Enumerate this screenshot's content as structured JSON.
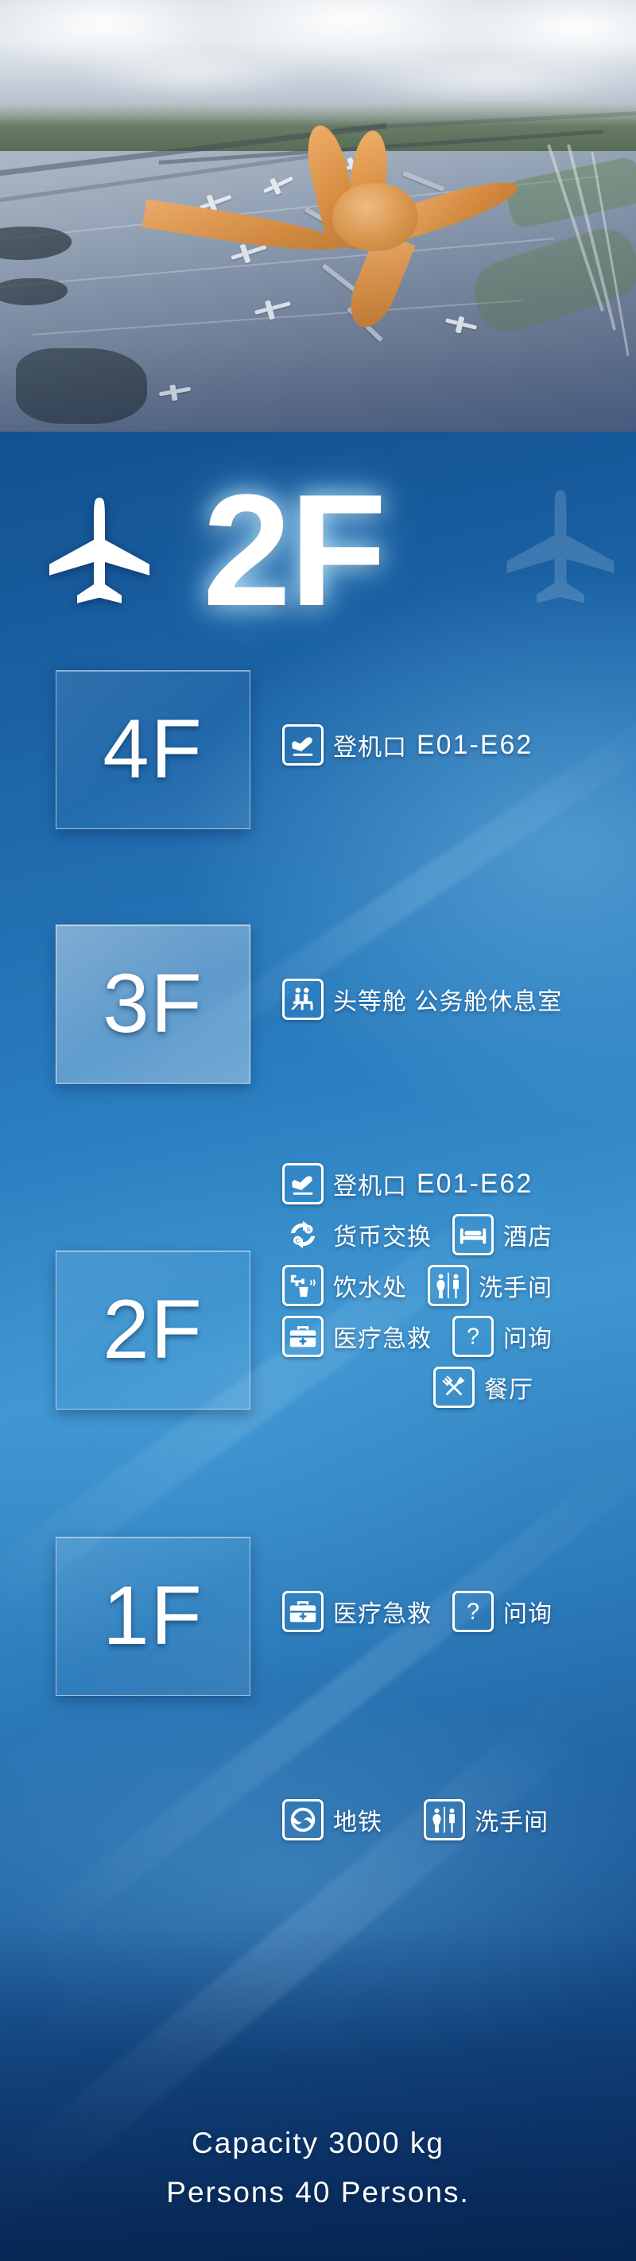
{
  "photo": {
    "alt_description": "Aerial rendering of Beijing Daxing International Airport terminal",
    "name": "airport-aerial-photo"
  },
  "header": {
    "floor_label": "2F",
    "plane_icon": "airplane-icon",
    "ghost_plane_icon": "airplane-watermark-icon"
  },
  "floors": [
    {
      "id": "4f",
      "label": "4F",
      "highlighted": false,
      "services": [
        [
          {
            "icon": "departure-plane-icon",
            "boxed": true,
            "label": "登机口",
            "code": "E01-E62"
          }
        ]
      ]
    },
    {
      "id": "3f",
      "label": "3F",
      "highlighted": true,
      "services": [
        [
          {
            "icon": "lounge-seat-icon",
            "boxed": true,
            "label": "头等舱  公务舱休息室",
            "code": ""
          }
        ]
      ]
    },
    {
      "id": "2f",
      "label": "2F",
      "highlighted": false,
      "services": [
        [
          {
            "icon": "departure-plane-icon",
            "boxed": true,
            "label": "登机口",
            "code": "E01-E62"
          }
        ],
        [
          {
            "icon": "currency-exchange-icon",
            "boxed": false,
            "label": "货币交换",
            "code": ""
          },
          {
            "icon": "hotel-bed-icon",
            "boxed": true,
            "label": "酒店",
            "code": ""
          }
        ],
        [
          {
            "icon": "drinking-water-icon",
            "boxed": true,
            "label": "饮水处",
            "code": ""
          },
          {
            "icon": "restroom-icon",
            "boxed": true,
            "label": "洗手间",
            "code": ""
          }
        ],
        [
          {
            "icon": "first-aid-kit-icon",
            "boxed": true,
            "label": "医疗急救",
            "code": ""
          },
          {
            "icon": "question-mark-icon",
            "boxed": true,
            "label": "问询",
            "code": ""
          }
        ],
        [
          {
            "icon": "restaurant-icon",
            "boxed": true,
            "label": "餐厅",
            "code": "",
            "indent": true
          }
        ]
      ]
    },
    {
      "id": "1f",
      "label": "1F",
      "highlighted": false,
      "services": [
        [
          {
            "icon": "first-aid-kit-icon",
            "boxed": true,
            "label": "医疗急救",
            "code": ""
          },
          {
            "icon": "question-mark-icon",
            "boxed": true,
            "label": "问询",
            "code": ""
          }
        ]
      ]
    }
  ],
  "transit": {
    "items": [
      {
        "icon": "metro-icon",
        "boxed": true,
        "label": "地铁"
      },
      {
        "icon": "restroom-icon",
        "boxed": true,
        "label": "洗手间"
      }
    ]
  },
  "capacity": {
    "line1": "Capacity   3000   kg",
    "line2": "Persons    40   Persons."
  },
  "colors": {
    "board_blue_dark": "#13518f",
    "board_blue_mid": "#2a7ec0",
    "board_blue_light": "#3f96d0",
    "board_blue_deep": "#0c3569",
    "text_white": "#ffffff",
    "terminal_orange": "#dd9040"
  }
}
